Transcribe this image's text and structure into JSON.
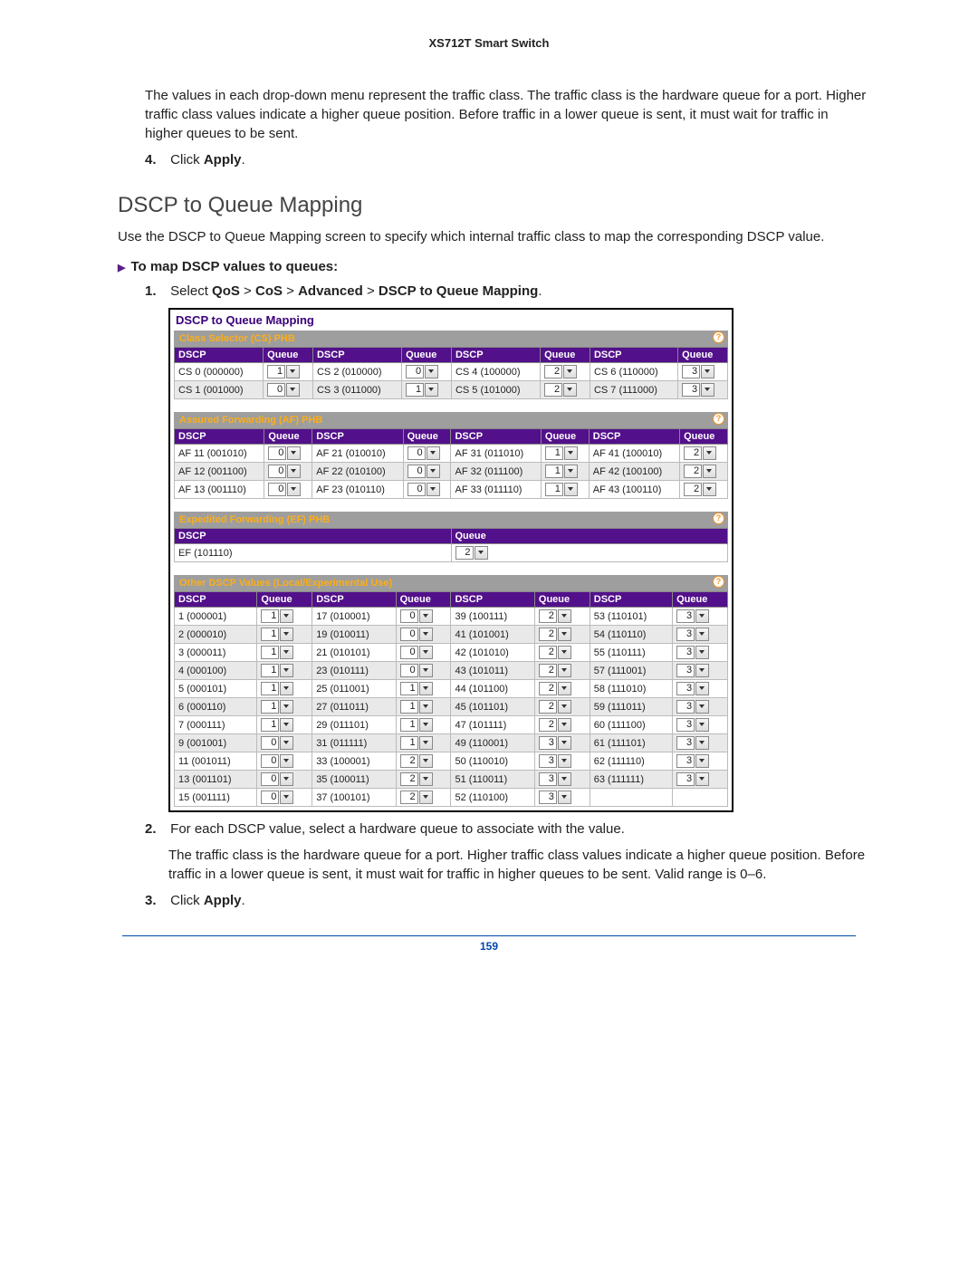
{
  "header": {
    "title": "XS712T Smart Switch"
  },
  "intro_p1": "The values in each drop-down menu represent the traffic class. The traffic class is the hardware queue for a port. Higher traffic class values indicate a higher queue position. Before traffic in a lower queue is sent, it must wait for traffic in higher queues to be sent.",
  "step4": {
    "num": "4.",
    "pre": "Click ",
    "bold": "Apply",
    "post": "."
  },
  "h2": "DSCP to Queue Mapping",
  "intro_p2": "Use the DSCP to Queue Mapping screen to specify which internal traffic class to map the corresponding DSCP value.",
  "subhead": "To map DSCP values to queues:",
  "step1": {
    "num": "1.",
    "pre": "Select ",
    "bold1": "QoS",
    "sep": " > ",
    "bold2": "CoS",
    "bold3": "Advanced",
    "bold4": "DSCP to Queue Mapping",
    "post": "."
  },
  "panel": {
    "title": "DSCP to Queue Mapping",
    "cs_title": "Class Selector (CS) PHB",
    "af_title": "Assured Forwarding (AF) PHB",
    "ef_title": "Expedited Forwarding (EF) PHB",
    "other_title": "Other DSCP Values (Local/Experimental Use)",
    "cols": {
      "dscp": "DSCP",
      "queue": "Queue"
    },
    "cs_rows": [
      [
        {
          "d": "CS 0 (000000)",
          "q": "1"
        },
        {
          "d": "CS 2 (010000)",
          "q": "0"
        },
        {
          "d": "CS 4 (100000)",
          "q": "2"
        },
        {
          "d": "CS 6 (110000)",
          "q": "3"
        }
      ],
      [
        {
          "d": "CS 1 (001000)",
          "q": "0"
        },
        {
          "d": "CS 3 (011000)",
          "q": "1"
        },
        {
          "d": "CS 5 (101000)",
          "q": "2"
        },
        {
          "d": "CS 7 (111000)",
          "q": "3"
        }
      ]
    ],
    "af_rows": [
      [
        {
          "d": "AF 11 (001010)",
          "q": "0"
        },
        {
          "d": "AF 21 (010010)",
          "q": "0"
        },
        {
          "d": "AF 31 (011010)",
          "q": "1"
        },
        {
          "d": "AF 41 (100010)",
          "q": "2"
        }
      ],
      [
        {
          "d": "AF 12 (001100)",
          "q": "0"
        },
        {
          "d": "AF 22 (010100)",
          "q": "0"
        },
        {
          "d": "AF 32 (011100)",
          "q": "1"
        },
        {
          "d": "AF 42 (100100)",
          "q": "2"
        }
      ],
      [
        {
          "d": "AF 13 (001110)",
          "q": "0"
        },
        {
          "d": "AF 23 (010110)",
          "q": "0"
        },
        {
          "d": "AF 33 (011110)",
          "q": "1"
        },
        {
          "d": "AF 43 (100110)",
          "q": "2"
        }
      ]
    ],
    "ef_rows": [
      [
        {
          "d": "EF (101110)",
          "q": "2"
        }
      ]
    ],
    "other_rows": [
      [
        {
          "d": "1 (000001)",
          "q": "1"
        },
        {
          "d": "17 (010001)",
          "q": "0"
        },
        {
          "d": "39 (100111)",
          "q": "2"
        },
        {
          "d": "53 (110101)",
          "q": "3"
        }
      ],
      [
        {
          "d": "2 (000010)",
          "q": "1"
        },
        {
          "d": "19 (010011)",
          "q": "0"
        },
        {
          "d": "41 (101001)",
          "q": "2"
        },
        {
          "d": "54 (110110)",
          "q": "3"
        }
      ],
      [
        {
          "d": "3 (000011)",
          "q": "1"
        },
        {
          "d": "21 (010101)",
          "q": "0"
        },
        {
          "d": "42 (101010)",
          "q": "2"
        },
        {
          "d": "55 (110111)",
          "q": "3"
        }
      ],
      [
        {
          "d": "4 (000100)",
          "q": "1"
        },
        {
          "d": "23 (010111)",
          "q": "0"
        },
        {
          "d": "43 (101011)",
          "q": "2"
        },
        {
          "d": "57 (111001)",
          "q": "3"
        }
      ],
      [
        {
          "d": "5 (000101)",
          "q": "1"
        },
        {
          "d": "25 (011001)",
          "q": "1"
        },
        {
          "d": "44 (101100)",
          "q": "2"
        },
        {
          "d": "58 (111010)",
          "q": "3"
        }
      ],
      [
        {
          "d": "6 (000110)",
          "q": "1"
        },
        {
          "d": "27 (011011)",
          "q": "1"
        },
        {
          "d": "45 (101101)",
          "q": "2"
        },
        {
          "d": "59 (111011)",
          "q": "3"
        }
      ],
      [
        {
          "d": "7 (000111)",
          "q": "1"
        },
        {
          "d": "29 (011101)",
          "q": "1"
        },
        {
          "d": "47 (101111)",
          "q": "2"
        },
        {
          "d": "60 (111100)",
          "q": "3"
        }
      ],
      [
        {
          "d": "9 (001001)",
          "q": "0"
        },
        {
          "d": "31 (011111)",
          "q": "1"
        },
        {
          "d": "49 (110001)",
          "q": "3"
        },
        {
          "d": "61 (111101)",
          "q": "3"
        }
      ],
      [
        {
          "d": "11 (001011)",
          "q": "0"
        },
        {
          "d": "33 (100001)",
          "q": "2"
        },
        {
          "d": "50 (110010)",
          "q": "3"
        },
        {
          "d": "62 (111110)",
          "q": "3"
        }
      ],
      [
        {
          "d": "13 (001101)",
          "q": "0"
        },
        {
          "d": "35 (100011)",
          "q": "2"
        },
        {
          "d": "51 (110011)",
          "q": "3"
        },
        {
          "d": "63 (111111)",
          "q": "3"
        }
      ],
      [
        {
          "d": "15 (001111)",
          "q": "0"
        },
        {
          "d": "37 (100101)",
          "q": "2"
        },
        {
          "d": "52 (110100)",
          "q": "3"
        }
      ]
    ]
  },
  "step2": {
    "num": "2.",
    "text": "For each DSCP value, select a hardware queue to associate with the value."
  },
  "step2para": "The traffic class is the hardware queue for a port. Higher traffic class values indicate a higher queue position. Before traffic in a lower queue is sent, it must wait for traffic in higher queues to be sent. Valid range is 0–6.",
  "step3": {
    "num": "3.",
    "pre": "Click ",
    "bold": "Apply",
    "post": "."
  },
  "page_number": "159"
}
